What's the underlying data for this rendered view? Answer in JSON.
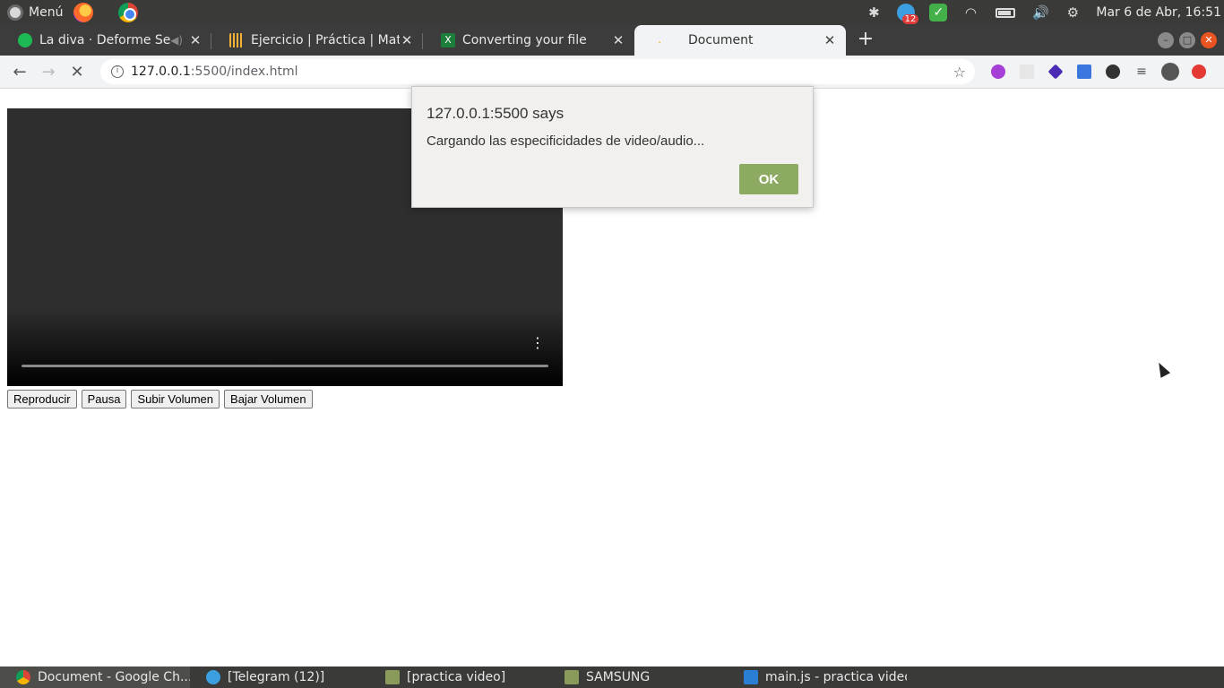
{
  "os_panel": {
    "menu_label": "Menú",
    "clock": "Mar  6 de Abr, 16:51",
    "telegram_badge": "12"
  },
  "tabs": [
    {
      "title": "La diva · Deforme Sem",
      "icon": "spotify-icon"
    },
    {
      "title": "Ejercicio | Práctica | Mater",
      "icon": "platzi-icon"
    },
    {
      "title": "Converting your file",
      "icon": "converter-icon"
    },
    {
      "title": "Document",
      "icon": "loading-icon",
      "active": true
    }
  ],
  "address_bar": {
    "host": "127.0.0.1",
    "path": ":5500/index.html"
  },
  "page": {
    "buttons": {
      "play": "Reproducir",
      "pause": "Pausa",
      "volume_up": "Subir Volumen",
      "volume_down": "Bajar Volumen"
    }
  },
  "dialog": {
    "title": "127.0.0.1:5500 says",
    "message": "Cargando las especificidades de video/audio...",
    "ok_label": "OK",
    "ok_color": "#8daa62"
  },
  "taskbar": [
    {
      "label": "Document - Google Ch...",
      "icon": "chrome-icon",
      "active": true
    },
    {
      "label": "[Telegram (12)]",
      "icon": "telegram-icon"
    },
    {
      "label": "[practica video]",
      "icon": "folder-icon"
    },
    {
      "label": "SAMSUNG",
      "icon": "folder-icon"
    },
    {
      "label": "main.js - practica video...",
      "icon": "vscode-icon"
    }
  ]
}
